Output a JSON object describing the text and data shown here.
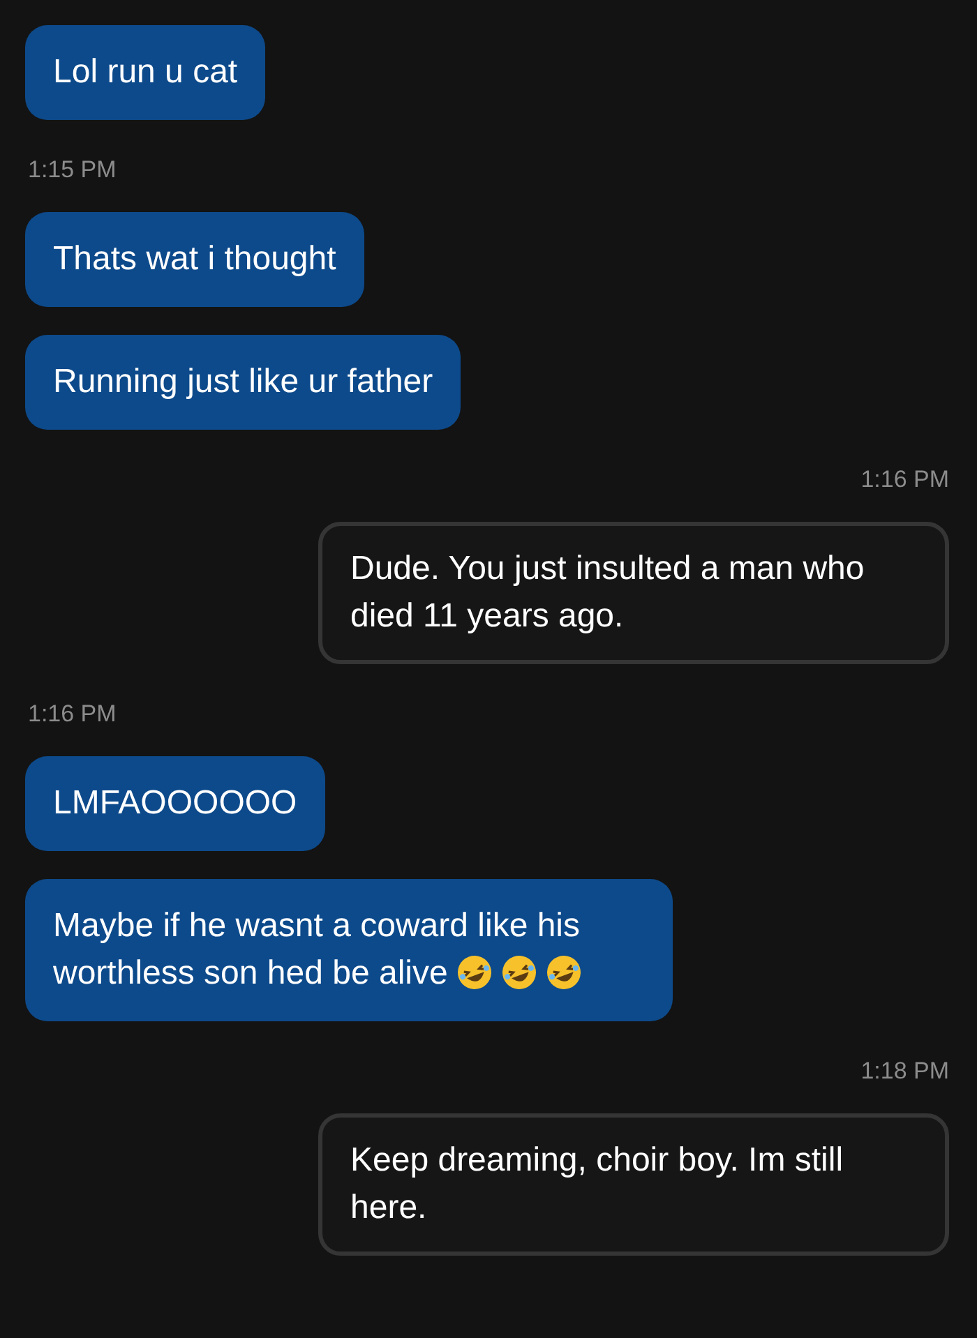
{
  "conversation": [
    {
      "kind": "message",
      "outgoing": false,
      "text": "Lol run u cat"
    },
    {
      "kind": "timestamp",
      "outgoing": false,
      "text": "1:15 PM"
    },
    {
      "kind": "message",
      "outgoing": false,
      "text": "Thats wat i thought"
    },
    {
      "kind": "message",
      "outgoing": false,
      "text": "Running just like ur father"
    },
    {
      "kind": "timestamp",
      "outgoing": true,
      "text": "1:16 PM"
    },
    {
      "kind": "message",
      "outgoing": true,
      "text": "Dude. You just insulted a man who died 11 years ago."
    },
    {
      "kind": "timestamp",
      "outgoing": false,
      "text": "1:16 PM"
    },
    {
      "kind": "message",
      "outgoing": false,
      "text": "LMFAOOOOOO"
    },
    {
      "kind": "message",
      "outgoing": false,
      "text": "Maybe if he wasnt a coward like his worthless son hed be alive",
      "emojis": [
        {
          "kind": "laughing"
        },
        {
          "kind": "laughing"
        },
        {
          "kind": "laughing"
        }
      ]
    },
    {
      "kind": "timestamp",
      "outgoing": true,
      "text": "1:18 PM"
    },
    {
      "kind": "message",
      "outgoing": true,
      "text": "Keep dreaming, choir boy. Im still here."
    }
  ]
}
